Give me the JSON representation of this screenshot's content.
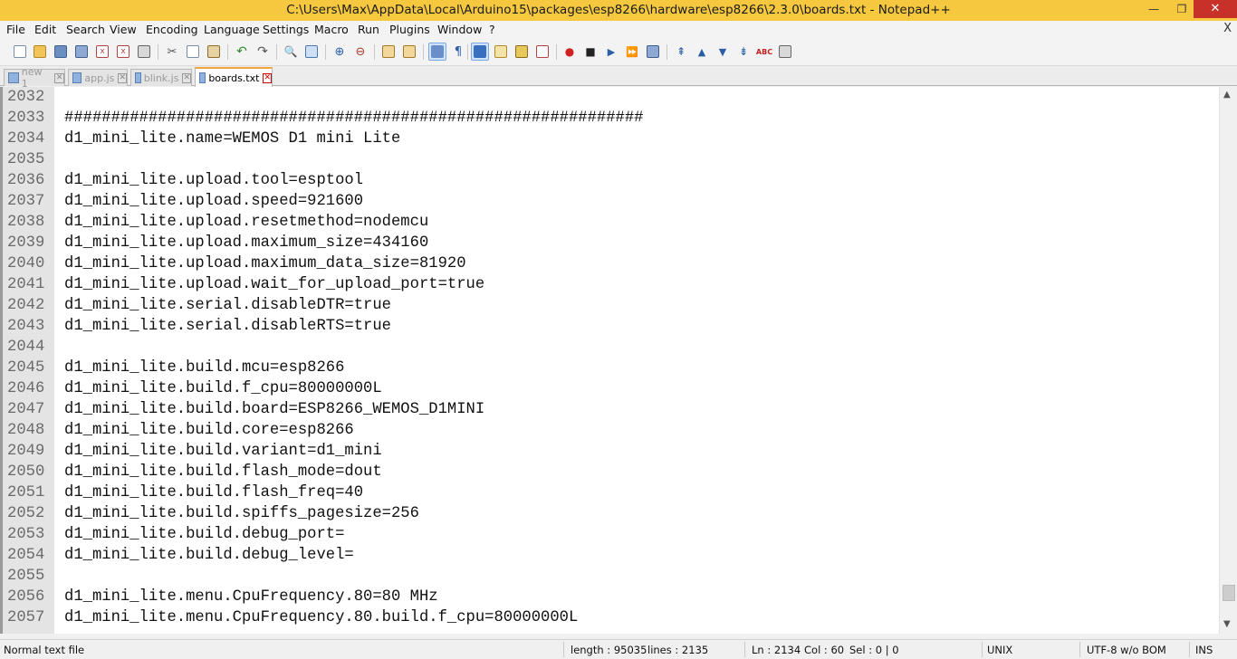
{
  "window": {
    "title": "C:\\Users\\Max\\AppData\\Local\\Arduino15\\packages\\esp8266\\hardware\\esp8266\\2.3.0\\boards.txt - Notepad++",
    "minimize": "—",
    "maximize": "❐",
    "close": "✕"
  },
  "menu": {
    "items": [
      "File",
      "Edit",
      "Search",
      "View",
      "Encoding",
      "Language",
      "Settings",
      "Macro",
      "Run",
      "Plugins",
      "Window",
      "?"
    ],
    "close_doc": "X"
  },
  "tabs": [
    {
      "label": "new  1",
      "active": false
    },
    {
      "label": "app.js",
      "active": false
    },
    {
      "label": "blink.js",
      "active": false
    },
    {
      "label": "boards.txt",
      "active": true
    }
  ],
  "editor": {
    "lines": [
      {
        "num": "2032",
        "text": ""
      },
      {
        "num": "2033",
        "text": "##############################################################"
      },
      {
        "num": "2034",
        "text": "d1_mini_lite.name=WEMOS D1 mini Lite"
      },
      {
        "num": "2035",
        "text": ""
      },
      {
        "num": "2036",
        "text": "d1_mini_lite.upload.tool=esptool"
      },
      {
        "num": "2037",
        "text": "d1_mini_lite.upload.speed=921600"
      },
      {
        "num": "2038",
        "text": "d1_mini_lite.upload.resetmethod=nodemcu"
      },
      {
        "num": "2039",
        "text": "d1_mini_lite.upload.maximum_size=434160"
      },
      {
        "num": "2040",
        "text": "d1_mini_lite.upload.maximum_data_size=81920"
      },
      {
        "num": "2041",
        "text": "d1_mini_lite.upload.wait_for_upload_port=true"
      },
      {
        "num": "2042",
        "text": "d1_mini_lite.serial.disableDTR=true"
      },
      {
        "num": "2043",
        "text": "d1_mini_lite.serial.disableRTS=true"
      },
      {
        "num": "2044",
        "text": ""
      },
      {
        "num": "2045",
        "text": "d1_mini_lite.build.mcu=esp8266"
      },
      {
        "num": "2046",
        "text": "d1_mini_lite.build.f_cpu=80000000L"
      },
      {
        "num": "2047",
        "text": "d1_mini_lite.build.board=ESP8266_WEMOS_D1MINI"
      },
      {
        "num": "2048",
        "text": "d1_mini_lite.build.core=esp8266"
      },
      {
        "num": "2049",
        "text": "d1_mini_lite.build.variant=d1_mini"
      },
      {
        "num": "2050",
        "text": "d1_mini_lite.build.flash_mode=dout"
      },
      {
        "num": "2051",
        "text": "d1_mini_lite.build.flash_freq=40"
      },
      {
        "num": "2052",
        "text": "d1_mini_lite.build.spiffs_pagesize=256"
      },
      {
        "num": "2053",
        "text": "d1_mini_lite.build.debug_port="
      },
      {
        "num": "2054",
        "text": "d1_mini_lite.build.debug_level="
      },
      {
        "num": "2055",
        "text": ""
      },
      {
        "num": "2056",
        "text": "d1_mini_lite.menu.CpuFrequency.80=80 MHz"
      },
      {
        "num": "2057",
        "text": "d1_mini_lite.menu.CpuFrequency.80.build.f_cpu=80000000L"
      }
    ],
    "scroll_position": 0.92
  },
  "status": {
    "file_type": "Normal text file",
    "length": "length : 95035",
    "lines": "lines : 2135",
    "ln": "Ln : 2134",
    "col": "Col : 60",
    "sel": "Sel : 0 | 0",
    "eol": "UNIX",
    "encoding": "UTF-8 w/o BOM",
    "mode": "INS"
  },
  "colors": {
    "titlebar": "#f5c840",
    "close_button": "#c7312a",
    "active_tab_accent": "#f2a53a",
    "gutter": "#e4e4e4"
  }
}
